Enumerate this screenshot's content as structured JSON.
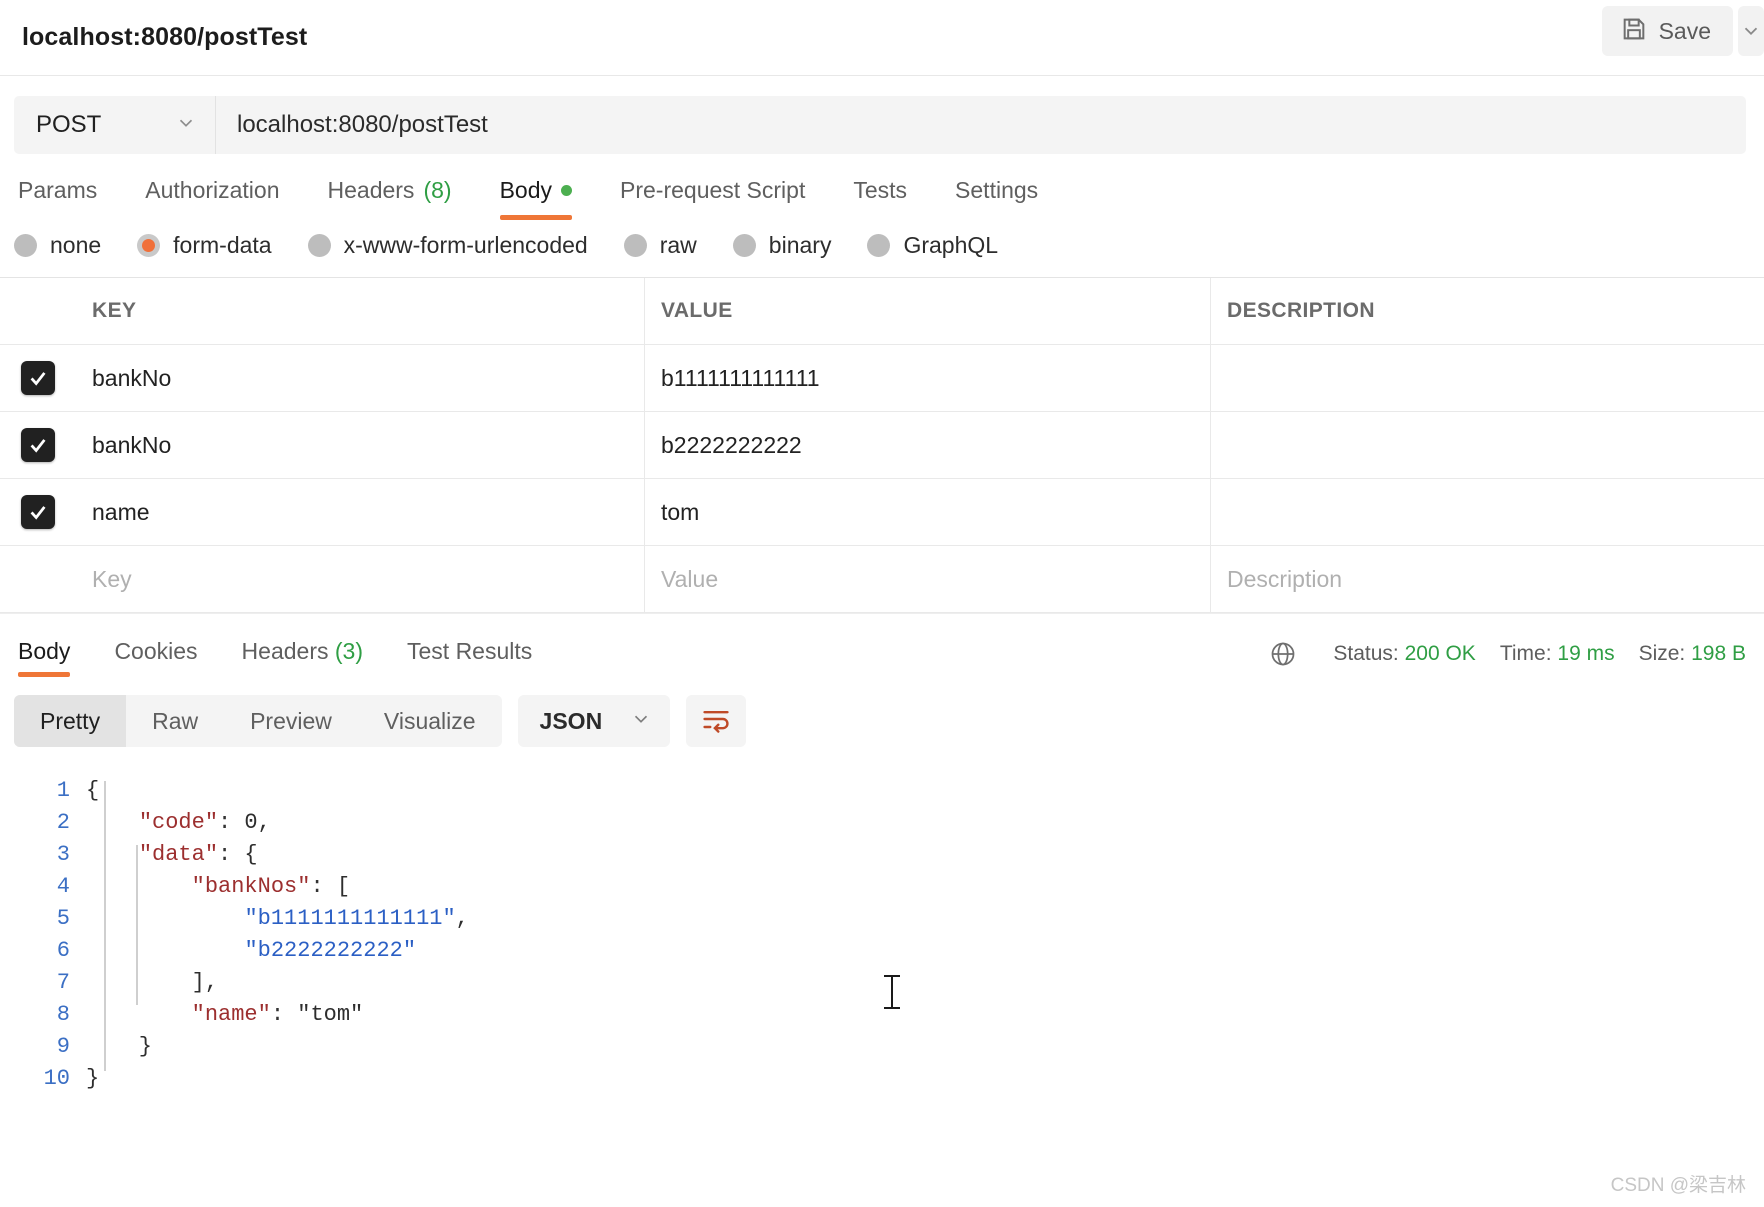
{
  "header": {
    "request_title": "localhost:8080/postTest",
    "save_label": "Save",
    "save_icon": "floppy-disk-icon",
    "save_caret_icon": "chevron-down-icon"
  },
  "url_bar": {
    "method": "POST",
    "method_caret_icon": "chevron-down-icon",
    "url": "localhost:8080/postTest"
  },
  "request_tabs": [
    {
      "label": "Params",
      "active": false
    },
    {
      "label": "Authorization",
      "active": false
    },
    {
      "label": "Headers",
      "count": "(8)",
      "active": false
    },
    {
      "label": "Body",
      "active": true,
      "has_dot": true
    },
    {
      "label": "Pre-request Script",
      "active": false
    },
    {
      "label": "Tests",
      "active": false
    },
    {
      "label": "Settings",
      "active": false
    }
  ],
  "body_types": [
    {
      "label": "none",
      "checked": false
    },
    {
      "label": "form-data",
      "checked": true
    },
    {
      "label": "x-www-form-urlencoded",
      "checked": false
    },
    {
      "label": "raw",
      "checked": false
    },
    {
      "label": "binary",
      "checked": false
    },
    {
      "label": "GraphQL",
      "checked": false
    }
  ],
  "form_table": {
    "columns": {
      "key": "KEY",
      "value": "VALUE",
      "description": "DESCRIPTION"
    },
    "rows": [
      {
        "checked": true,
        "key": "bankNo",
        "value": "b1111111111111",
        "description": ""
      },
      {
        "checked": true,
        "key": "bankNo",
        "value": "b2222222222",
        "description": ""
      },
      {
        "checked": true,
        "key": "name",
        "value": "tom",
        "description": ""
      }
    ],
    "new_row_placeholders": {
      "key": "Key",
      "value": "Value",
      "description": "Description"
    }
  },
  "response_tabs": [
    {
      "label": "Body",
      "active": true
    },
    {
      "label": "Cookies",
      "active": false
    },
    {
      "label": "Headers",
      "count": "(3)",
      "active": false
    },
    {
      "label": "Test Results",
      "active": false
    }
  ],
  "response_meta": {
    "globe_icon": "globe-icon",
    "status_label": "Status:",
    "status_value": "200 OK",
    "time_label": "Time:",
    "time_value": "19 ms",
    "size_label": "Size:",
    "size_value": "198 B"
  },
  "viewer_toolbar": {
    "segments": [
      {
        "label": "Pretty",
        "active": true
      },
      {
        "label": "Raw",
        "active": false
      },
      {
        "label": "Preview",
        "active": false
      },
      {
        "label": "Visualize",
        "active": false
      }
    ],
    "format": "JSON",
    "format_caret_icon": "chevron-down-icon",
    "wrap_icon": "word-wrap-icon"
  },
  "response_body": {
    "line_numbers": [
      "1",
      "2",
      "3",
      "4",
      "5",
      "6",
      "7",
      "8",
      "9",
      "10"
    ],
    "raw": "{\n    \"code\": 0,\n    \"data\": {\n        \"bankNos\": [\n            \"b1111111111111\",\n            \"b2222222222\"\n        ],\n        \"name\": \"tom\"\n    }\n}",
    "parsed": {
      "code": 0,
      "data": {
        "bankNos": [
          "b1111111111111",
          "b2222222222"
        ],
        "name": "tom"
      }
    }
  },
  "watermark": "CSDN @梁吉林",
  "colors": {
    "accent_orange": "#ef7637",
    "status_green": "#2f9e44",
    "json_key": "#9c2f2f",
    "json_string": "#2b5fc4",
    "json_number": "#2f8a4e",
    "line_number": "#3b6fc4"
  }
}
